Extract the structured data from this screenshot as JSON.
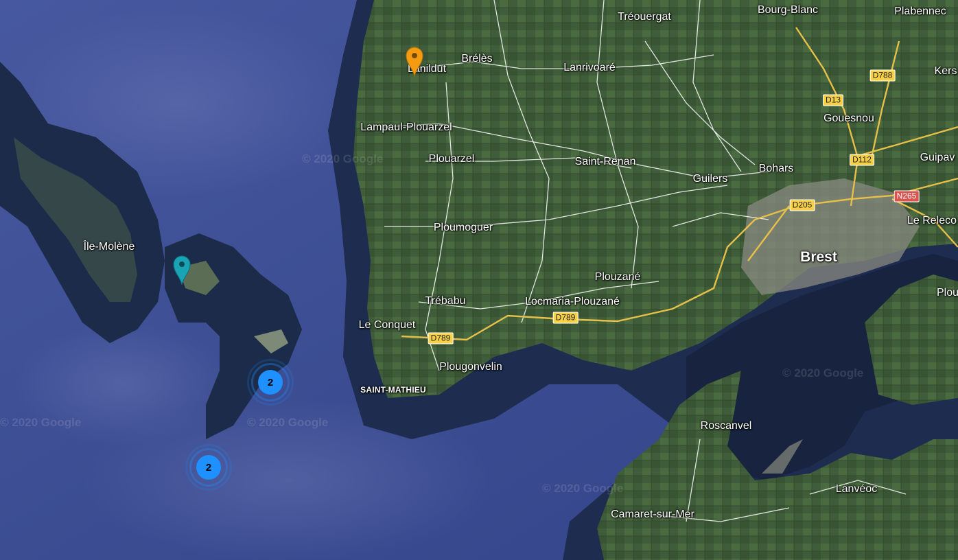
{
  "colors": {
    "sea": "#3d4f95",
    "land": "#3c5a3a",
    "road": "#ffffff",
    "highway": "#f2c94c",
    "cluster": "#1e90ff",
    "pin_orange": "#f39c12",
    "pin_teal": "#1aa3b5"
  },
  "places": {
    "treouergat": "Tréouergat",
    "bourg_blanc": "Bourg-Blanc",
    "plabennec": "Plabennec",
    "lanildut": "Lanildut",
    "breles": "Brélès",
    "lanrivoare": "Lanrivoaré",
    "kers": "Kers",
    "gouesnou": "Gouesnou",
    "lampaul": "Lampaul-Plouarzel",
    "plouarzel": "Plouarzel",
    "saint_renan": "Saint-Renan",
    "guilers": "Guilers",
    "bohars": "Bohars",
    "guipav": "Guipav",
    "ploumoguer": "Ploumoguer",
    "le_releco": "Le Releco",
    "brest": "Brest",
    "ile_molene": "Île-Molène",
    "plouzane": "Plouzané",
    "trebabu": "Trébabu",
    "locmaria": "Locmaria-Plouzané",
    "plou": "Plou",
    "le_conquet": "Le Conquet",
    "plougonvelin": "Plougonvelin",
    "saint_mathieu": "SAINT-MATHIEU",
    "roscanvel": "Roscanvel",
    "lanveoc": "Lanvéoc",
    "camaret": "Camaret-sur-Mer"
  },
  "roads": {
    "d788": "D788",
    "d13": "D13",
    "d112": "D112",
    "d205": "D205",
    "n265": "N265",
    "d789a": "D789",
    "d789b": "D789"
  },
  "copyright": "© 2020 Google",
  "clusters": {
    "c1": "2",
    "c2": "2"
  },
  "markers": {
    "orange": "marker-orange",
    "teal": "marker-teal"
  }
}
